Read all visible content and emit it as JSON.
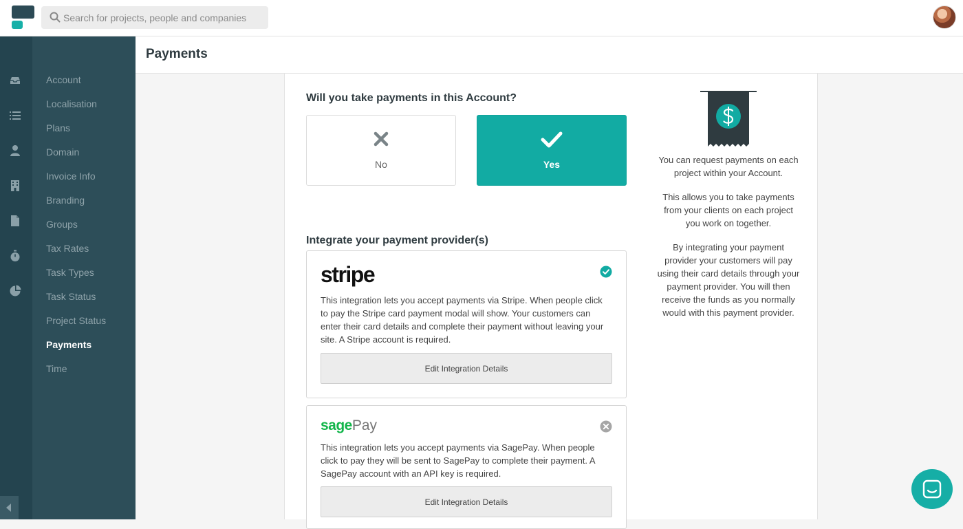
{
  "app": {
    "search": {
      "placeholder": "Search for projects, people and companies"
    }
  },
  "colors": {
    "accent": "#12aba3",
    "rail": "#24444f",
    "nav": "#2d4e59",
    "sage_green": "#12b54a"
  },
  "rail": {
    "icons": [
      "inbox-icon",
      "list-icon",
      "person-icon",
      "building-icon",
      "document-icon",
      "stopwatch-icon",
      "pie-chart-icon"
    ],
    "collapse_icon": "collapse-left-icon"
  },
  "nav": {
    "items": [
      {
        "label": "Account"
      },
      {
        "label": "Localisation"
      },
      {
        "label": "Plans"
      },
      {
        "label": "Domain"
      },
      {
        "label": "Invoice Info"
      },
      {
        "label": "Branding"
      },
      {
        "label": "Groups"
      },
      {
        "label": "Tax Rates"
      },
      {
        "label": "Task Types"
      },
      {
        "label": "Task Status"
      },
      {
        "label": "Project Status"
      },
      {
        "label": "Payments",
        "active": true
      },
      {
        "label": "Time"
      }
    ]
  },
  "page": {
    "title": "Payments"
  },
  "question": {
    "title": "Will you take payments in this Account?",
    "no_label": "No",
    "yes_label": "Yes",
    "selected": "Yes"
  },
  "integrations": {
    "title": "Integrate your payment provider(s)",
    "stripe": {
      "logo_text": "stripe",
      "status": "enabled",
      "description": "This integration lets you accept payments via Stripe. When people click to pay the Stripe card payment modal will show. Your customers can enter their card details and complete their payment without leaving your site. A Stripe account is required.",
      "button": "Edit Integration Details"
    },
    "sagepay": {
      "logo_sage": "sage",
      "logo_pay": "Pay",
      "status": "disabled",
      "description": "This integration lets you accept payments via SagePay. When people click to pay they will be sent to SagePay to complete their payment. A SagePay account with an API key is required.",
      "button": "Edit Integration Details"
    }
  },
  "info": {
    "p1": "You can request payments on each project within your Account.",
    "p2": "This allows you to take payments from your clients on each project you work on together.",
    "p3": "By integrating your payment provider your customers will pay using their card details through your payment provider. You will then receive the funds as you normally would with this payment provider."
  }
}
